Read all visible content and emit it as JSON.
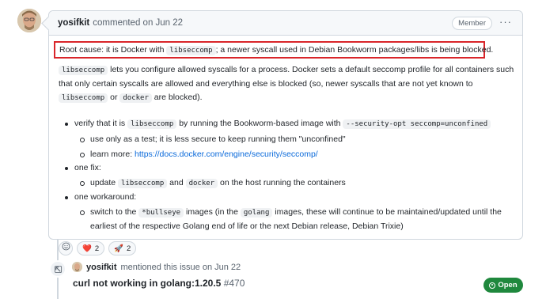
{
  "comment": {
    "author": "yosifkit",
    "action": "commented on Jun 22",
    "role_badge": "Member",
    "more_icon": "kebab-horizontal-icon",
    "root_cause": {
      "before": "Root cause: it is Docker with ",
      "code": "libseccomp",
      "after": "; a newer syscall used in Debian Bookworm packages/libs is being blocked."
    },
    "paragraph": {
      "code1": "libseccomp",
      "text1": " lets you configure allowed syscalls for a process. Docker sets a default seccomp profile for all containers such that only certain syscalls are allowed and everything else is blocked (so, newer syscalls that are not yet known to ",
      "code2": "libseccomp",
      "text2": " or ",
      "code3": "docker",
      "text3": " are blocked)."
    },
    "bullets": {
      "verify": {
        "before": "verify that it is ",
        "code1": "libseccomp",
        "mid": " by running the Bookworm-based image with ",
        "code2": "--security-opt seccomp=unconfined",
        "sub1": "use only as a test; it is less secure to keep running them \"unconfined\"",
        "sub2_prefix": "learn more: ",
        "sub2_link": "https://docs.docker.com/engine/security/seccomp/"
      },
      "fix": {
        "label": "one fix:",
        "sub_before": "update ",
        "code1": "libseccomp",
        "sub_mid": " and ",
        "code2": "docker",
        "sub_after": " on the host running the containers"
      },
      "workaround": {
        "label": "one workaround:",
        "sub_before": "switch to the ",
        "code1": "*bullseye",
        "sub_mid": " images (in the ",
        "code2": "golang",
        "sub_after": " images, these will continue to be maintained/updated until the earliest of the respective Golang end of life or the next Debian release, Debian Trixie)"
      }
    },
    "reactions": [
      {
        "emoji": "❤️",
        "count": "2",
        "icon": "heart-reaction-icon"
      },
      {
        "emoji": "🚀",
        "count": "2",
        "icon": "rocket-reaction-icon"
      }
    ]
  },
  "mention_event": {
    "author": "yosifkit",
    "text": "mentioned this issue on Jun 22",
    "ref_title": "curl not working in golang:1.20.5",
    "ref_number": "#470",
    "status": "Open",
    "status_color": "#1f883d"
  }
}
